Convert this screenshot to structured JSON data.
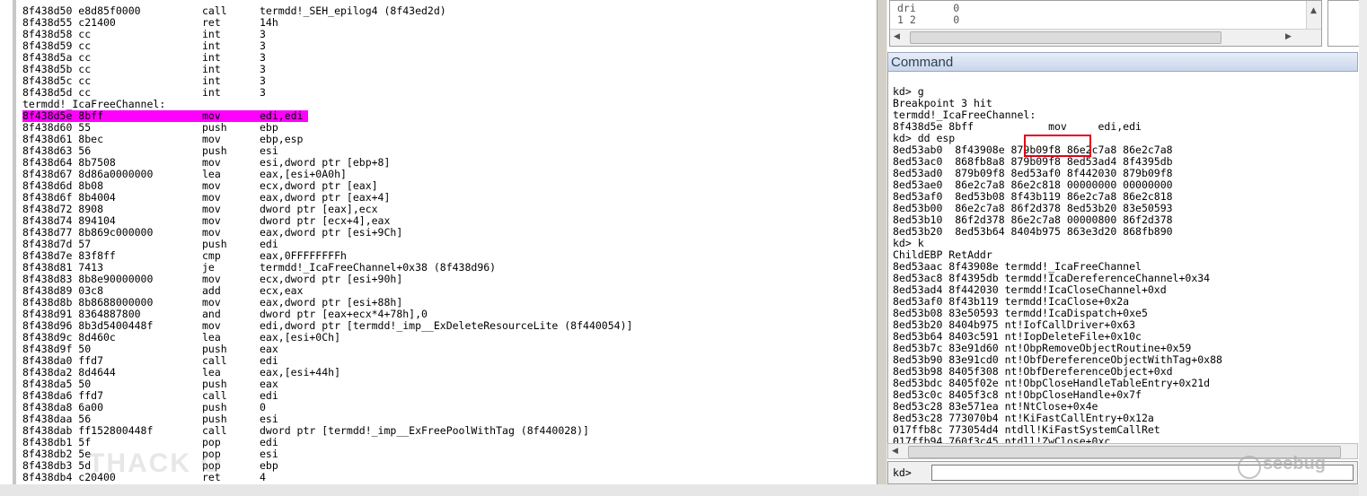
{
  "disassembly": {
    "rows": [
      {
        "addr": "8f438d50 e8d85f0000",
        "mn": "call",
        "op": "termdd!_SEH_epilog4 (8f43ed2d)"
      },
      {
        "addr": "8f438d55 c21400",
        "mn": "ret",
        "op": "14h"
      },
      {
        "addr": "8f438d58 cc",
        "mn": "int",
        "op": "3"
      },
      {
        "addr": "8f438d59 cc",
        "mn": "int",
        "op": "3"
      },
      {
        "addr": "8f438d5a cc",
        "mn": "int",
        "op": "3"
      },
      {
        "addr": "8f438d5b cc",
        "mn": "int",
        "op": "3"
      },
      {
        "addr": "8f438d5c cc",
        "mn": "int",
        "op": "3"
      },
      {
        "addr": "8f438d5d cc",
        "mn": "int",
        "op": "3"
      },
      {
        "label": "termdd!_IcaFreeChannel:"
      },
      {
        "addr": "8f438d5e 8bff",
        "mn": "mov",
        "op": "edi,edi",
        "hl": true
      },
      {
        "addr": "8f438d60 55",
        "mn": "push",
        "op": "ebp"
      },
      {
        "addr": "8f438d61 8bec",
        "mn": "mov",
        "op": "ebp,esp"
      },
      {
        "addr": "8f438d63 56",
        "mn": "push",
        "op": "esi"
      },
      {
        "addr": "8f438d64 8b7508",
        "mn": "mov",
        "op": "esi,dword ptr [ebp+8]"
      },
      {
        "addr": "8f438d67 8d86a0000000",
        "mn": "lea",
        "op": "eax,[esi+0A0h]"
      },
      {
        "addr": "8f438d6d 8b08",
        "mn": "mov",
        "op": "ecx,dword ptr [eax]"
      },
      {
        "addr": "8f438d6f 8b4004",
        "mn": "mov",
        "op": "eax,dword ptr [eax+4]"
      },
      {
        "addr": "8f438d72 8908",
        "mn": "mov",
        "op": "dword ptr [eax],ecx"
      },
      {
        "addr": "8f438d74 894104",
        "mn": "mov",
        "op": "dword ptr [ecx+4],eax"
      },
      {
        "addr": "8f438d77 8b869c000000",
        "mn": "mov",
        "op": "eax,dword ptr [esi+9Ch]"
      },
      {
        "addr": "8f438d7d 57",
        "mn": "push",
        "op": "edi"
      },
      {
        "addr": "8f438d7e 83f8ff",
        "mn": "cmp",
        "op": "eax,0FFFFFFFFh"
      },
      {
        "addr": "8f438d81 7413",
        "mn": "je",
        "op": "termdd!_IcaFreeChannel+0x38 (8f438d96)"
      },
      {
        "addr": "8f438d83 8b8e90000000",
        "mn": "mov",
        "op": "ecx,dword ptr [esi+90h]"
      },
      {
        "addr": "8f438d89 03c8",
        "mn": "add",
        "op": "ecx,eax"
      },
      {
        "addr": "8f438d8b 8b8688000000",
        "mn": "mov",
        "op": "eax,dword ptr [esi+88h]"
      },
      {
        "addr": "8f438d91 8364887800",
        "mn": "and",
        "op": "dword ptr [eax+ecx*4+78h],0"
      },
      {
        "addr": "8f438d96 8b3d5400448f",
        "mn": "mov",
        "op": "edi,dword ptr [termdd!_imp__ExDeleteResourceLite (8f440054)]"
      },
      {
        "addr": "8f438d9c 8d460c",
        "mn": "lea",
        "op": "eax,[esi+0Ch]"
      },
      {
        "addr": "8f438d9f 50",
        "mn": "push",
        "op": "eax"
      },
      {
        "addr": "8f438da0 ffd7",
        "mn": "call",
        "op": "edi"
      },
      {
        "addr": "8f438da2 8d4644",
        "mn": "lea",
        "op": "eax,[esi+44h]"
      },
      {
        "addr": "8f438da5 50",
        "mn": "push",
        "op": "eax"
      },
      {
        "addr": "8f438da6 ffd7",
        "mn": "call",
        "op": "edi"
      },
      {
        "addr": "8f438da8 6a00",
        "mn": "push",
        "op": "0"
      },
      {
        "addr": "8f438daa 56",
        "mn": "push",
        "op": "esi"
      },
      {
        "addr": "8f438dab ff152800448f",
        "mn": "call",
        "op": "dword ptr [termdd!_imp__ExFreePoolWithTag (8f440028)]"
      },
      {
        "addr": "8f438db1 5f",
        "mn": "pop",
        "op": "edi"
      },
      {
        "addr": "8f438db2 5e",
        "mn": "pop",
        "op": "esi"
      },
      {
        "addr": "8f438db3 5d",
        "mn": "pop",
        "op": "ebp"
      },
      {
        "addr": "8f438db4 c20400",
        "mn": "ret",
        "op": "4"
      }
    ],
    "watermark": "THACK O"
  },
  "locals": {
    "row1": "dri      0",
    "row2": "1 2      0"
  },
  "command": {
    "title": "Command",
    "lines": [
      "kd> g",
      "Breakpoint 3 hit",
      "termdd!_IcaFreeChannel:",
      "8f438d5e 8bff            mov     edi,edi",
      "kd> dd esp",
      "8ed53ab0  8f43908e 879b09f8 86e2c7a8 86e2c7a8",
      "8ed53ac0  868fb8a8 879b09f8 8ed53ad4 8f4395db",
      "8ed53ad0  879b09f8 8ed53af0 8f442030 879b09f8",
      "8ed53ae0  86e2c7a8 86e2c818 00000000 00000000",
      "8ed53af0  8ed53b08 8f43b119 86e2c7a8 86e2c818",
      "8ed53b00  86e2c7a8 86f2d378 8ed53b20 83e50593",
      "8ed53b10  86f2d378 86e2c7a8 00000800 86f2d378",
      "8ed53b20  8ed53b64 8404b975 863e3d20 868fb890",
      "kd> k",
      "ChildEBP RetAddr",
      "8ed53aac 8f43908e termdd!_IcaFreeChannel",
      "8ed53ac8 8f4395db termdd!IcaDereferenceChannel+0x34",
      "8ed53ad4 8f442030 termdd!IcaCloseChannel+0xd",
      "8ed53af0 8f43b119 termdd!IcaClose+0x2a",
      "8ed53b08 83e50593 termdd!IcaDispatch+0xe5",
      "8ed53b20 8404b975 nt!IofCallDriver+0x63",
      "8ed53b64 8403c591 nt!IopDeleteFile+0x10c",
      "8ed53b7c 83e91d60 nt!ObpRemoveObjectRoutine+0x59",
      "8ed53b90 83e91cd0 nt!ObfDereferenceObjectWithTag+0x88",
      "8ed53b98 8405f308 nt!ObfDereferenceObject+0xd",
      "8ed53bdc 8405f02e nt!ObpCloseHandleTableEntry+0x21d",
      "8ed53c0c 8405f3c8 nt!ObpCloseHandle+0x7f",
      "8ed53c28 83e571ea nt!NtClose+0x4e",
      "8ed53c28 773070b4 nt!KiFastCallEntry+0x12a",
      "017ffb8c 773054d4 ntdll!KiFastSystemCallRet",
      "017ffb94 760f3c45 ntdll!ZwClose+0xc"
    ],
    "prompt": "kd>",
    "input_value": ""
  },
  "branding": {
    "seebug": "seebug"
  },
  "colors": {
    "highlight": "#ff00ff",
    "annotation_box": "#e0001a"
  }
}
